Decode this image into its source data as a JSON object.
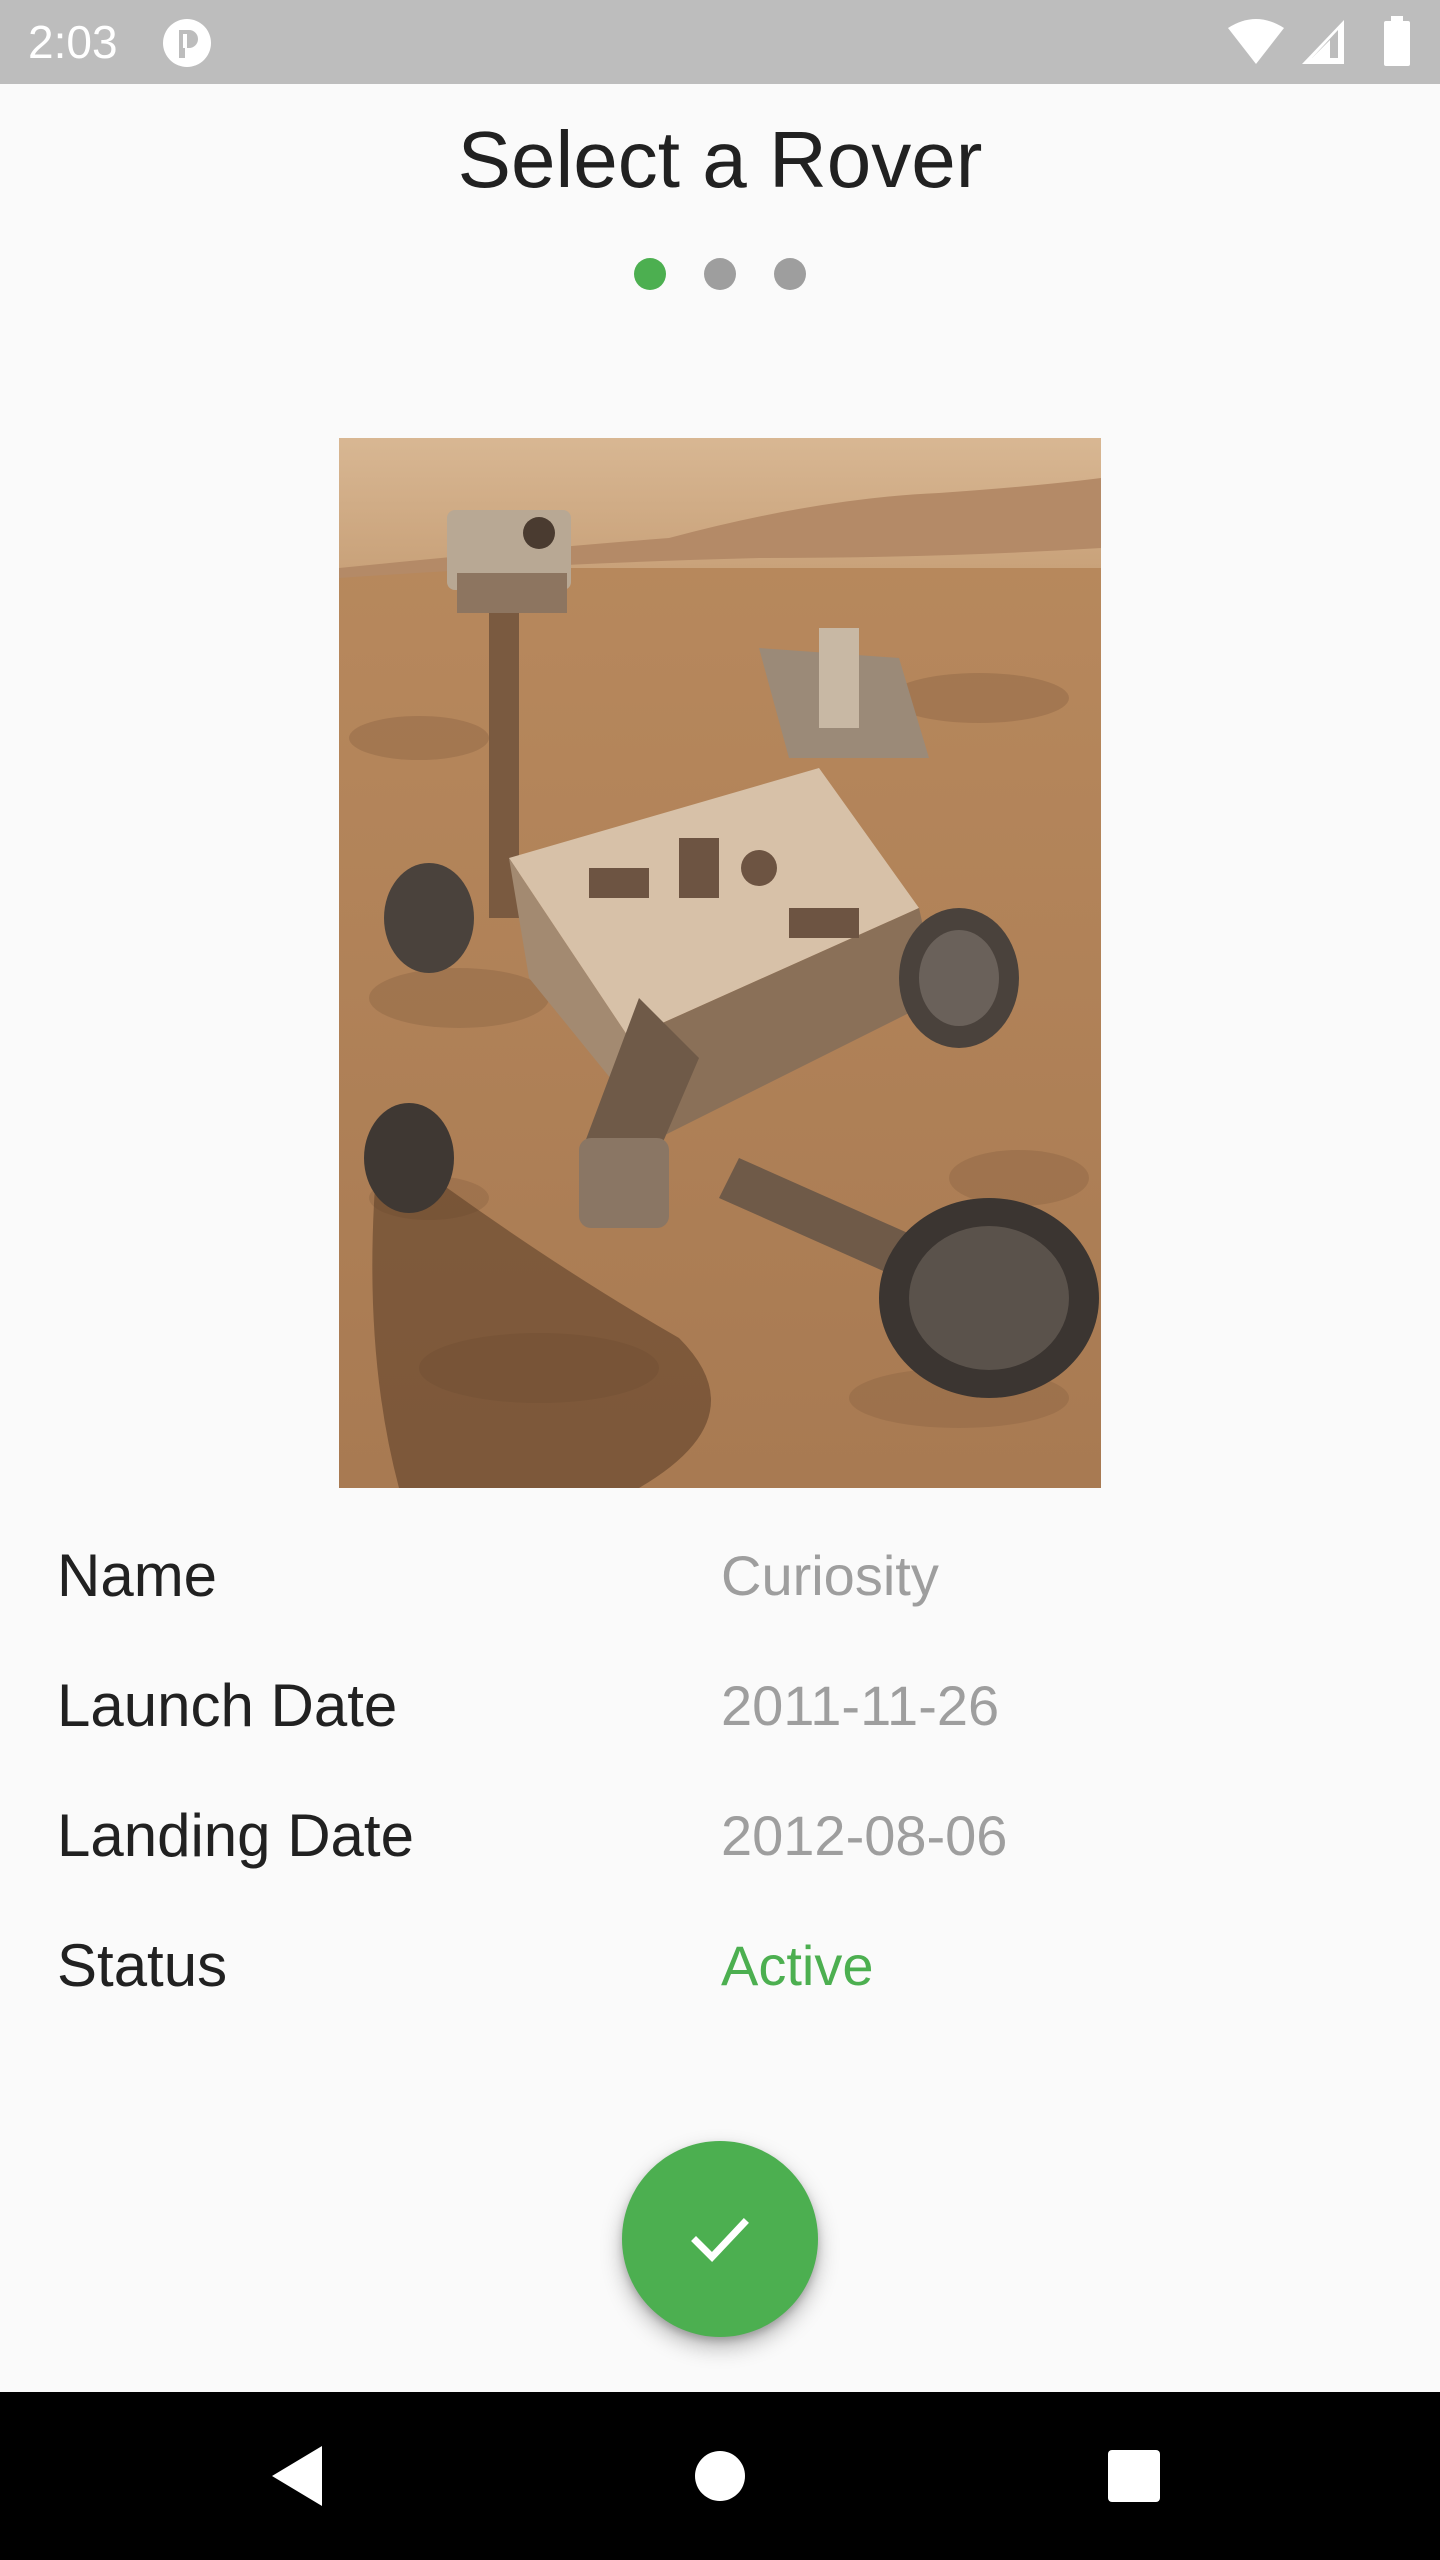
{
  "status_bar": {
    "time": "2:03",
    "icons": [
      "app-notification-icon",
      "wifi-icon",
      "cell-signal-icon",
      "battery-icon"
    ]
  },
  "header": {
    "title": "Select a Rover"
  },
  "pager": {
    "page_count": 3,
    "active_index": 0,
    "colors": {
      "active": "#4caf50",
      "inactive": "#9e9e9e"
    }
  },
  "rover": {
    "image_icon": "rover-photo",
    "details": [
      {
        "label": "Name",
        "value": "Curiosity"
      },
      {
        "label": "Launch Date",
        "value": "2011-11-26"
      },
      {
        "label": "Landing Date",
        "value": "2012-08-06"
      },
      {
        "label": "Status",
        "value": "Active"
      }
    ]
  },
  "fab": {
    "icon": "check-icon",
    "color": "#4caf50"
  },
  "nav_bar": {
    "icons": [
      "back-icon",
      "home-icon",
      "recents-icon"
    ]
  },
  "colors": {
    "accent": "#4caf50",
    "status_bar": "#bdbdbd",
    "text_primary": "#212121",
    "text_secondary": "#9e9e9e"
  }
}
